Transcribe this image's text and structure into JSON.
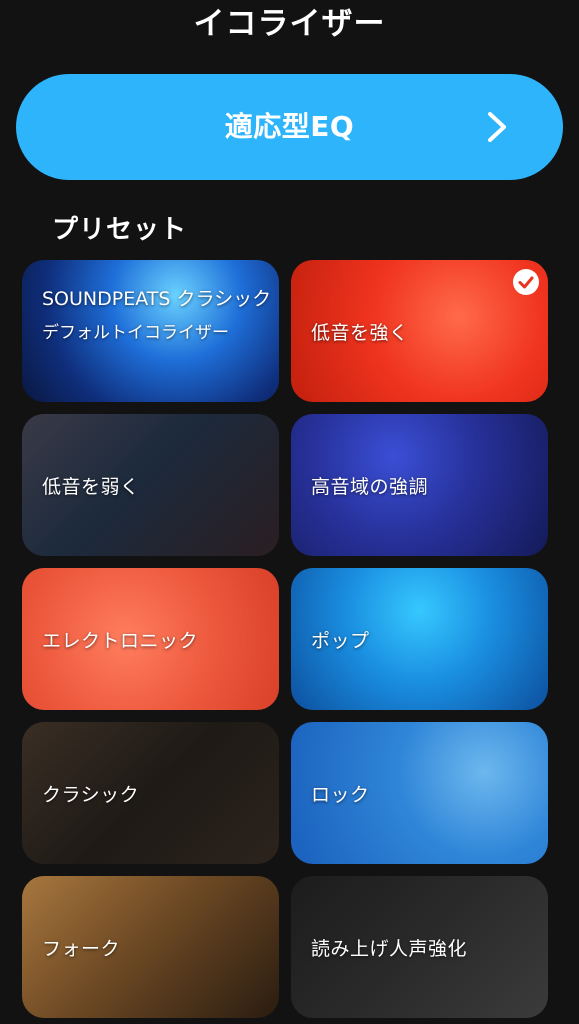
{
  "header": {
    "title": "イコライザー"
  },
  "adaptive_eq": {
    "label": "適応型EQ",
    "icon": "chevron-right-icon",
    "color": "#2eb4fb"
  },
  "presets": {
    "section_title": "プリセット",
    "selected": "低音を強く",
    "items": [
      {
        "label": "SOUNDPEATS クラシック",
        "sublabel": "デフォルトイコライザー"
      },
      {
        "label": "低音を強く"
      },
      {
        "label": "低音を弱く"
      },
      {
        "label": "高音域の強調"
      },
      {
        "label": "エレクトロニック"
      },
      {
        "label": "ポップ"
      },
      {
        "label": "クラシック"
      },
      {
        "label": "ロック"
      },
      {
        "label": "フォーク"
      },
      {
        "label": "読み上げ人声強化"
      }
    ]
  },
  "colors": {
    "background": "#121212",
    "accent": "#2eb4fb"
  }
}
